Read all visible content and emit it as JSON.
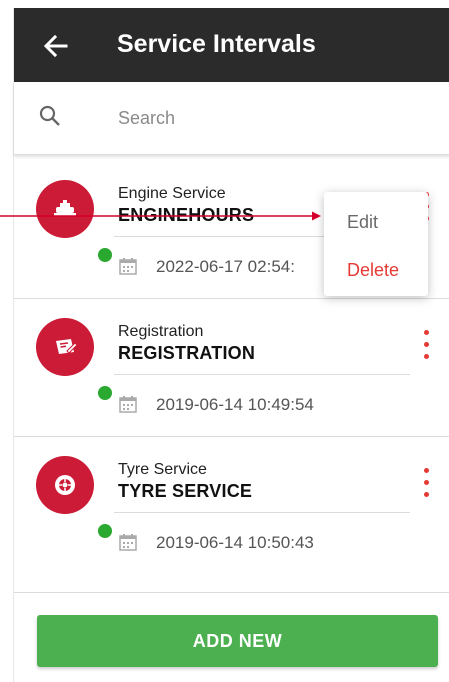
{
  "header": {
    "title": "Service Intervals",
    "back_icon": "arrow-left-icon"
  },
  "search": {
    "placeholder": "Search",
    "icon": "search-icon"
  },
  "items": [
    {
      "type_label": "Engine Service",
      "name": "ENGINEHOURS",
      "date": "2022-06-17 02:54:",
      "icon": "engine-icon",
      "status": "online"
    },
    {
      "type_label": "Registration",
      "name": "REGISTRATION",
      "date": "2019-06-14 10:49:54",
      "icon": "registration-card-icon",
      "status": "online"
    },
    {
      "type_label": "Tyre Service",
      "name": "TYRE SERVICE",
      "date": "2019-06-14 10:50:43",
      "icon": "tyre-icon",
      "status": "online"
    }
  ],
  "context_menu": {
    "edit_label": "Edit",
    "delete_label": "Delete"
  },
  "footer": {
    "add_label": "ADD NEW"
  },
  "colors": {
    "header": "#2b2b2b",
    "avatar": "#cc1b36",
    "status": "#2aa82f",
    "kebab": "#e53935",
    "add_button": "#4caf50",
    "arrow": "#d4002a"
  }
}
